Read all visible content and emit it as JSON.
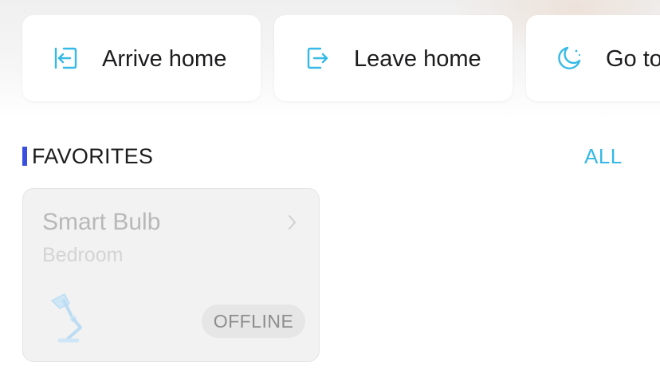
{
  "scenes": [
    {
      "label": "Arrive home",
      "icon": "arrive-home-icon"
    },
    {
      "label": "Leave home",
      "icon": "leave-home-icon"
    },
    {
      "label": "Go to",
      "icon": "moon-icon"
    }
  ],
  "favorites": {
    "title": "FAVORITES",
    "all_label": "ALL",
    "accent_color": "#3a4fe0",
    "link_color": "#35b9e6"
  },
  "devices": [
    {
      "name": "Smart Bulb",
      "room": "Bedroom",
      "status": "OFFLINE",
      "icon": "desk-lamp-icon"
    }
  ]
}
